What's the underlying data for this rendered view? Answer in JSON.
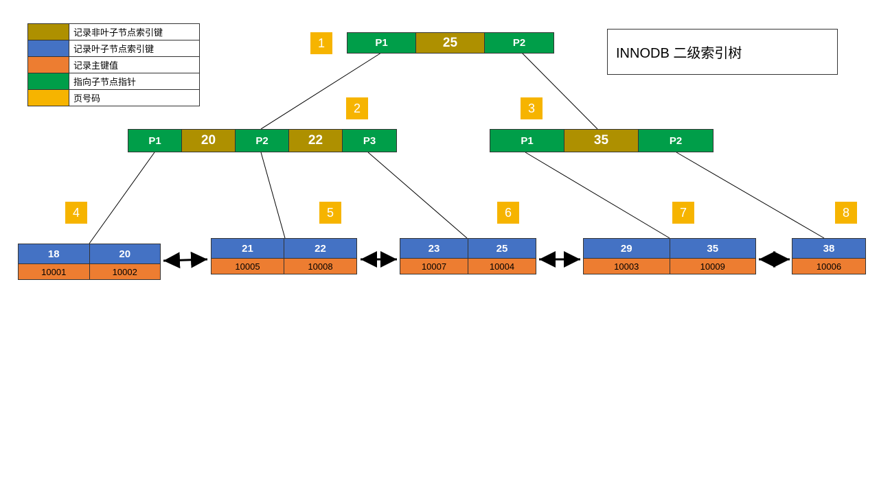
{
  "title": "INNODB 二级索引树",
  "colors": {
    "olive": "#ae9000",
    "blue": "#4472c4",
    "orange": "#ed7d31",
    "green": "#009e49",
    "yellow": "#f6b400"
  },
  "legend": [
    {
      "color": "olive",
      "label": "记录非叶子节点索引键"
    },
    {
      "color": "blue",
      "label": "记录叶子节点索引键"
    },
    {
      "color": "orange",
      "label": "记录主键值"
    },
    {
      "color": "green",
      "label": "指向子节点指针"
    },
    {
      "color": "yellow",
      "label": "页号码"
    }
  ],
  "badges": {
    "b1": "1",
    "b2": "2",
    "b3": "3",
    "b4": "4",
    "b5": "5",
    "b6": "6",
    "b7": "7",
    "b8": "8"
  },
  "root": {
    "cells": [
      {
        "text": "P1",
        "color": "green"
      },
      {
        "text": "25",
        "color": "olive"
      },
      {
        "text": "P2",
        "color": "green"
      }
    ]
  },
  "mid_left": {
    "cells": [
      {
        "text": "P1",
        "color": "green"
      },
      {
        "text": "20",
        "color": "olive"
      },
      {
        "text": "P2",
        "color": "green"
      },
      {
        "text": "22",
        "color": "olive"
      },
      {
        "text": "P3",
        "color": "green"
      }
    ]
  },
  "mid_right": {
    "cells": [
      {
        "text": "P1",
        "color": "green"
      },
      {
        "text": "35",
        "color": "olive"
      },
      {
        "text": "P2",
        "color": "green"
      }
    ]
  },
  "leaves": [
    {
      "keys": [
        "18",
        "20"
      ],
      "pks": [
        "10001",
        "10002"
      ]
    },
    {
      "keys": [
        "21",
        "22"
      ],
      "pks": [
        "10005",
        "10008"
      ]
    },
    {
      "keys": [
        "23",
        "25"
      ],
      "pks": [
        "10007",
        "10004"
      ]
    },
    {
      "keys": [
        "29",
        "35"
      ],
      "pks": [
        "10003",
        "10009"
      ]
    },
    {
      "keys": [
        "38"
      ],
      "pks": [
        "10006"
      ]
    }
  ]
}
